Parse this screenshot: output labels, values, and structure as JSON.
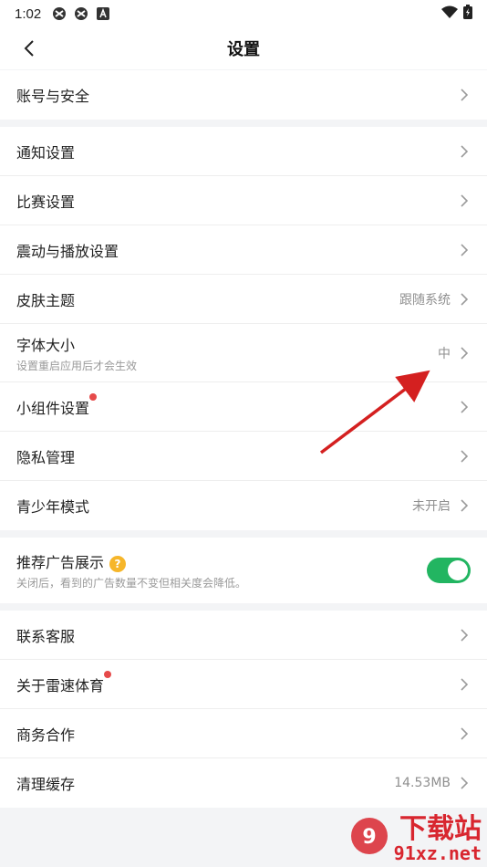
{
  "status": {
    "time": "1:02"
  },
  "nav": {
    "title": "设置"
  },
  "group1": [
    {
      "label": "账号与安全"
    }
  ],
  "group2": [
    {
      "label": "通知设置"
    },
    {
      "label": "比赛设置"
    },
    {
      "label": "震动与播放设置"
    },
    {
      "label": "皮肤主题",
      "value": "跟随系统"
    },
    {
      "label": "字体大小",
      "sub": "设置重启应用后才会生效",
      "value": "中"
    },
    {
      "label": "小组件设置",
      "dot": true
    },
    {
      "label": "隐私管理"
    },
    {
      "label": "青少年模式",
      "value": "未开启"
    }
  ],
  "ads": {
    "label": "推荐广告展示",
    "help": "?",
    "sub": "关闭后，看到的广告数量不变但相关度会降低。",
    "enabled": true
  },
  "group3": [
    {
      "label": "联系客服"
    },
    {
      "label": "关于雷速体育",
      "dot": true
    },
    {
      "label": "商务合作"
    },
    {
      "label": "清理缓存",
      "value": "14.53MB"
    }
  ],
  "watermark": {
    "title": "下载站",
    "site": "91xz.net"
  },
  "colors": {
    "toggle_on": "#22b561",
    "badge": "#e64a4a",
    "help": "#f6b62a",
    "annotation_arrow": "#d42020"
  }
}
